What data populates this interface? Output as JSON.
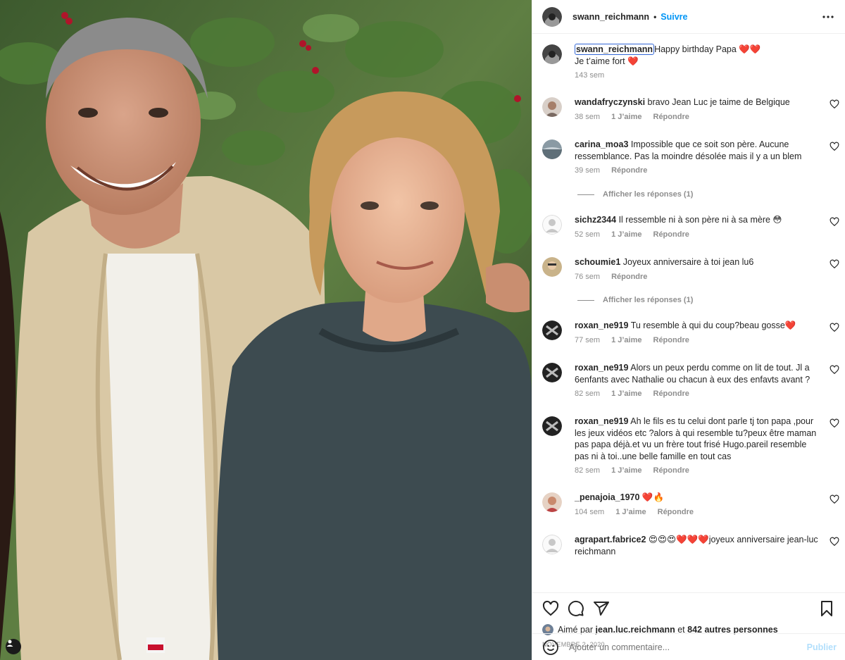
{
  "header": {
    "username": "swann_reichmann",
    "separator": "•",
    "follow_label": "Suivre",
    "more_icon": "more-horizontal-icon"
  },
  "caption": {
    "username": "swann_reichmann",
    "line1": "Happy birthday Papa ❤️❤️",
    "line2": "Je t’aime fort ❤️",
    "time": "143 sem"
  },
  "comments": [
    {
      "username": "wandafryczynski",
      "text": "bravo Jean Luc je taime de Belgique",
      "time": "38 sem",
      "likes": "1 J’aime",
      "reply": "Répondre"
    },
    {
      "username": "carina_moa3",
      "text": "Impossible que ce soit son père. Aucune ressemblance. Pas la moindre désolée mais il y a un blem",
      "time": "39 sem",
      "likes": "",
      "reply": "Répondre",
      "show_replies": "Afficher les réponses (1)"
    },
    {
      "username": "sichz2344",
      "text": "Il ressemble ni à son père ni à sa mère 😳",
      "time": "52 sem",
      "likes": "1 J’aime",
      "reply": "Répondre"
    },
    {
      "username": "schoumie1",
      "text": "Joyeux anniversaire à toi jean lu6",
      "time": "76 sem",
      "likes": "",
      "reply": "Répondre",
      "show_replies": "Afficher les réponses (1)"
    },
    {
      "username": "roxan_ne919",
      "text": "Tu resemble à qui du coup?beau gosse❤️",
      "time": "77 sem",
      "likes": "1 J’aime",
      "reply": "Répondre"
    },
    {
      "username": "roxan_ne919",
      "text": "Alors un peux perdu comme on lit de tout. Jl a 6enfants avec Nathalie ou chacun à eux des enfavts avant ?",
      "time": "82 sem",
      "likes": "1 J’aime",
      "reply": "Répondre"
    },
    {
      "username": "roxan_ne919",
      "text": "Ah le fils es tu celui dont parle tj ton papa ,pour les jeux vidéos etc ?alors à qui resemble tu?peux être maman pas papa déjà.et vu un frère tout frisé Hugo.pareil resemble pas ni à toi..une belle famille en tout cas",
      "time": "82 sem",
      "likes": "1 J’aime",
      "reply": "Répondre"
    },
    {
      "username": "_penajoia_1970",
      "text": "❤️🔥",
      "time": "104 sem",
      "likes": "1 J’aime",
      "reply": "Répondre"
    },
    {
      "username": "agrapart.fabrice2",
      "text": "😍😍😍❤️❤️❤️joyeux anniversaire jean-luc reichmann",
      "time": "",
      "likes": "",
      "reply": ""
    }
  ],
  "actions": {
    "liked_prefix": "Aimé par",
    "liked_user": "jean.luc.reichmann",
    "liked_and": "et",
    "liked_others": "842 autres personnes",
    "date": "NOVEMBRE 2, 2020"
  },
  "add_comment": {
    "placeholder": "Ajouter un commentaire...",
    "publish_label": "Publier"
  },
  "colors": {
    "accent": "#0095f6",
    "publish_disabled": "#b2dffc",
    "muted": "#8e8e8e",
    "focus_border": "#3367d6"
  }
}
